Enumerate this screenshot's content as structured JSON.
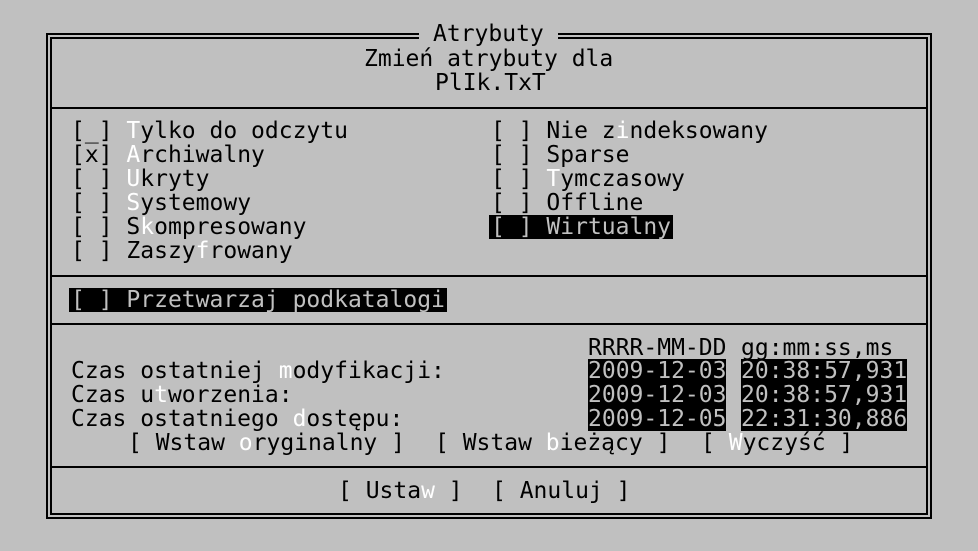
{
  "dialog": {
    "title": "Atrybuty",
    "subtitle": "Zmień atrybuty dla",
    "filename": "PlIk.TxT"
  },
  "attributes_left": [
    {
      "box": "[_]",
      "hk": "T",
      "rest": "ylko do odczytu"
    },
    {
      "box": "[x]",
      "hk": "A",
      "rest": "rchiwalny"
    },
    {
      "box": "[ ]",
      "hk": "U",
      "rest": "kryty"
    },
    {
      "box": "[ ]",
      "hk": "S",
      "rest": "ystemowy"
    },
    {
      "box": "[ ]",
      "pre": "S",
      "hk": "k",
      "rest": "ompresowany"
    },
    {
      "box": "[ ]",
      "pre": "Zaszy",
      "hk": "f",
      "rest": "rowany"
    }
  ],
  "attributes_right": [
    {
      "box": "[ ]",
      "pre": "Nie z",
      "hk": "i",
      "rest": "ndeksowany"
    },
    {
      "box": "[ ]",
      "pre": "Sparse",
      "hk": "",
      "rest": ""
    },
    {
      "box": "[ ]",
      "hk": "T",
      "rest": "ymczasowy"
    },
    {
      "box": "[ ]",
      "pre": "Offline",
      "hk": "",
      "rest": ""
    },
    {
      "box": "[ ]",
      "pre": "Wirtualny",
      "hk": "",
      "rest": ""
    }
  ],
  "recurse": {
    "box": "[ ]",
    "label": "Przetwarzaj podkatalogi"
  },
  "times": {
    "header_date": "RRRR-MM-DD",
    "header_time": "gg:mm:ss,ms",
    "rows": [
      {
        "pre": "Czas ostatniej ",
        "hk": "m",
        "rest": "odyfikacji:",
        "date": "2009-12-03",
        "time": "20:38:57,931"
      },
      {
        "pre": "Czas u",
        "hk": "t",
        "rest": "worzenia:",
        "date": "2009-12-03",
        "time": "20:38:57,931"
      },
      {
        "pre": "Czas ostatniego ",
        "hk": "d",
        "rest": "ostępu:",
        "date": "2009-12-05",
        "time": "22:31:30,886"
      }
    ]
  },
  "time_buttons": [
    {
      "pre": "[ Wstaw ",
      "hk": "o",
      "rest": "ryginalny ]"
    },
    {
      "pre": "[ Wstaw ",
      "hk": "b",
      "rest": "ieżący ]"
    },
    {
      "pre": "[ ",
      "hk": "W",
      "rest": "yczyść ]"
    }
  ],
  "buttons": {
    "set": {
      "pre": "[ Usta",
      "hk": "w",
      "rest": " ]"
    },
    "cancel": {
      "label": "[ Anuluj ]"
    }
  }
}
